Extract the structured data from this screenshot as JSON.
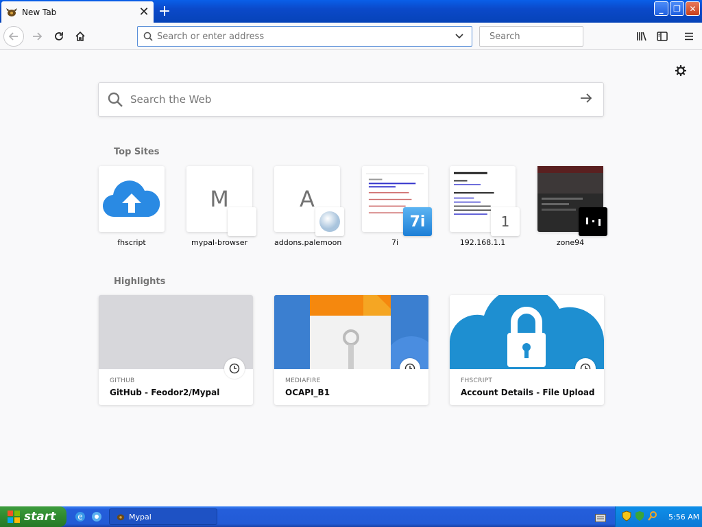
{
  "tab": {
    "title": "New Tab",
    "close": "✕"
  },
  "window": {
    "newtab": "+",
    "minimize": "_",
    "maximize": "❐",
    "close": "✕"
  },
  "nav": {
    "address_placeholder": "Search or enter address",
    "search_placeholder": "Search"
  },
  "content": {
    "web_search_placeholder": "Search the Web",
    "top_sites_title": "Top Sites",
    "highlights_title": "Highlights",
    "top_sites": [
      {
        "label": "fhscript",
        "letter": ""
      },
      {
        "label": "mypal-browser",
        "letter": "M"
      },
      {
        "label": "addons.palemoon",
        "letter": "A"
      },
      {
        "label": "7i",
        "letter": "",
        "badge": "7i"
      },
      {
        "label": "192.168.1.1",
        "letter": "",
        "badge": "1"
      },
      {
        "label": "zone94",
        "letter": ""
      }
    ],
    "highlights": [
      {
        "source": "GITHUB",
        "title": "GitHub - Feodor2/Mypal"
      },
      {
        "source": "MEDIAFIRE",
        "title": "OCAPI_B1"
      },
      {
        "source": "FHSCRIPT",
        "title": "Account Details - File Upload Scr..."
      }
    ]
  },
  "taskbar": {
    "start": "start",
    "task_label": "Mypal",
    "time": "5:56 AM"
  },
  "colors": {
    "accent": "#0a84ff",
    "xp_blue": "#245edb",
    "start_green": "#2f8a2f"
  }
}
